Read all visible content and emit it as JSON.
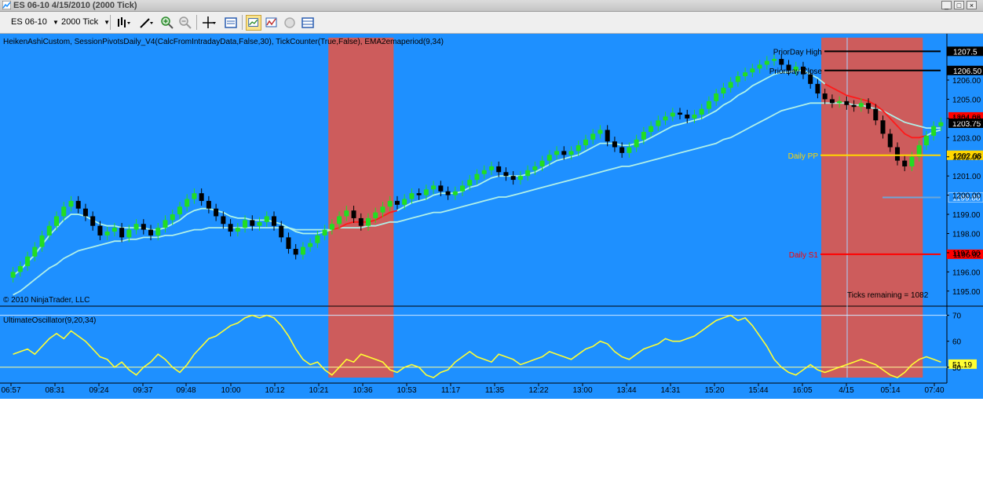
{
  "window": {
    "title": "ES 06-10  4/15/2010 (2000 Tick)"
  },
  "toolbar": {
    "instrument": "ES 06-10",
    "interval": "2000 Tick",
    "icons": [
      "bar-type-icon",
      "draw-pen-icon",
      "zoom-in-icon",
      "zoom-out-icon",
      "crosshair-icon",
      "data-box-icon",
      "strategy-icon",
      "indicator-icon",
      "properties-icon",
      "grid-icon"
    ]
  },
  "colors": {
    "background": "#1e90ff",
    "session_shade": "#cd5c5c",
    "candle_up": "#22dd22",
    "candle_down": "#000000",
    "ema_fast": "#aff5e8",
    "ema_slow": "#b0f0e8",
    "oscillator": "#ffff33",
    "pivot": "#ffd700",
    "s1": "#ff0000",
    "resistance": "#000000"
  },
  "price_panel": {
    "indicator_label": "HeikenAshiCustom, SessionPivotsDaily_V4(CalcFromIntradayData,False,30), TickCounter(True,False), EMA2emaperiod(9,34)",
    "copyright": "© 2010 NinjaTrader, LLC",
    "ticks_remaining": "Ticks remaining = 1082",
    "pivots": [
      {
        "label": "PriorDay High",
        "value": 1207.5,
        "tag": "1207.5",
        "color": "#000000"
      },
      {
        "label": "PriorDay Close",
        "value": 1206.5,
        "tag": "1206.50",
        "color": "#000000"
      },
      {
        "label": "Daily PP",
        "value": 1202.08,
        "tag": "1202.08",
        "color": "#ffd700"
      },
      {
        "label": "Daily S1",
        "value": 1196.92,
        "tag": "1196.92",
        "color": "#ff0000"
      }
    ],
    "price_tags": [
      {
        "value": 1204.08,
        "tag": "1204.08",
        "bg": "#ff0000",
        "fg": "#000000"
      },
      {
        "value": 1203.75,
        "tag": "1203.75",
        "bg": "#000000",
        "fg": "#ffffff"
      },
      {
        "value": 1199.88,
        "tag": "1199.88",
        "bg": "#1e90ff",
        "fg": "#ffffff"
      }
    ],
    "axis_ticks": [
      "1206.00",
      "1205.00",
      "1204.00",
      "1203.00",
      "1202.00",
      "1201.00",
      "1200.00",
      "1199.00",
      "1198.00",
      "1197.00",
      "1196.00",
      "1195.00"
    ]
  },
  "oscillator_panel": {
    "label": "UltimateOscillator(9,20,34)",
    "current_value": "51.19",
    "axis_ticks": [
      "70",
      "60",
      "50"
    ]
  },
  "time_axis": [
    "06:57",
    "08:31",
    "09:24",
    "09:37",
    "09:48",
    "10:00",
    "10:12",
    "10:21",
    "10:36",
    "10:53",
    "11:17",
    "11:35",
    "12:22",
    "13:00",
    "13:44",
    "14:31",
    "15:20",
    "15:44",
    "16:05",
    "4/15",
    "05:14",
    "07:40"
  ],
  "chart_data": {
    "type": "candlestick",
    "y_range": [
      1194.5,
      1207.8
    ],
    "oscillator_range": [
      46,
      72
    ],
    "oscillator_reference_lines": [
      70,
      50
    ],
    "candles_close": [
      1196.0,
      1196.3,
      1196.8,
      1197.3,
      1197.9,
      1198.4,
      1198.9,
      1199.4,
      1199.7,
      1199.3,
      1198.9,
      1198.4,
      1197.9,
      1198.1,
      1198.3,
      1197.8,
      1198.2,
      1198.5,
      1198.2,
      1197.9,
      1198.3,
      1198.7,
      1199.0,
      1199.4,
      1199.8,
      1200.1,
      1199.7,
      1199.3,
      1198.9,
      1198.5,
      1198.1,
      1198.3,
      1198.7,
      1198.4,
      1198.6,
      1198.9,
      1198.4,
      1197.8,
      1197.2,
      1196.9,
      1197.3,
      1197.5,
      1197.9,
      1198.2,
      1198.5,
      1198.9,
      1199.2,
      1198.8,
      1198.4,
      1198.8,
      1199.1,
      1199.4,
      1199.7,
      1199.5,
      1199.8,
      1200.1,
      1200.0,
      1200.3,
      1200.5,
      1200.2,
      1200.0,
      1200.2,
      1200.5,
      1200.8,
      1201.1,
      1201.3,
      1201.5,
      1201.2,
      1201.0,
      1200.8,
      1201.0,
      1201.3,
      1201.5,
      1201.8,
      1202.1,
      1202.3,
      1202.1,
      1202.3,
      1202.6,
      1202.9,
      1203.2,
      1203.4,
      1202.8,
      1202.5,
      1202.2,
      1202.5,
      1202.9,
      1203.3,
      1203.6,
      1203.9,
      1204.1,
      1204.3,
      1204.2,
      1204.0,
      1204.2,
      1204.5,
      1204.9,
      1205.3,
      1205.6,
      1205.9,
      1206.2,
      1206.4,
      1206.6,
      1206.8,
      1207.0,
      1207.1,
      1206.8,
      1206.5,
      1206.7,
      1206.3,
      1205.8,
      1205.3,
      1205.0,
      1204.8,
      1204.9,
      1204.7,
      1204.6,
      1204.8,
      1204.5,
      1203.9,
      1203.2,
      1202.5,
      1201.8,
      1201.5,
      1202.0,
      1202.6,
      1203.1,
      1203.6,
      1203.8
    ],
    "ema_fast": [
      1195.8,
      1196.1,
      1196.5,
      1196.9,
      1197.4,
      1197.9,
      1198.3,
      1198.7,
      1199.0,
      1199.0,
      1198.9,
      1198.7,
      1198.5,
      1198.4,
      1198.4,
      1198.3,
      1198.3,
      1198.3,
      1198.3,
      1198.2,
      1198.2,
      1198.3,
      1198.5,
      1198.7,
      1199.0,
      1199.2,
      1199.3,
      1199.3,
      1199.2,
      1199.1,
      1198.9,
      1198.8,
      1198.8,
      1198.7,
      1198.7,
      1198.7,
      1198.6,
      1198.5,
      1198.3,
      1198.1,
      1198.0,
      1198.0,
      1198.0,
      1198.1,
      1198.2,
      1198.3,
      1198.5,
      1198.6,
      1198.6,
      1198.6,
      1198.7,
      1198.9,
      1199.1,
      1199.2,
      1199.4,
      1199.6,
      1199.7,
      1199.8,
      1200.0,
      1200.1,
      1200.1,
      1200.1,
      1200.2,
      1200.4,
      1200.5,
      1200.7,
      1200.9,
      1201.0,
      1201.0,
      1201.0,
      1201.0,
      1201.1,
      1201.2,
      1201.4,
      1201.6,
      1201.8,
      1201.9,
      1202.0,
      1202.1,
      1202.3,
      1202.5,
      1202.7,
      1202.7,
      1202.7,
      1202.6,
      1202.6,
      1202.7,
      1202.8,
      1203.0,
      1203.2,
      1203.4,
      1203.6,
      1203.7,
      1203.8,
      1203.9,
      1204.0,
      1204.2,
      1204.4,
      1204.7,
      1204.9,
      1205.2,
      1205.4,
      1205.7,
      1205.9,
      1206.1,
      1206.3,
      1206.4,
      1206.4,
      1206.5,
      1206.5,
      1206.3,
      1206.1,
      1205.8,
      1205.6,
      1205.4,
      1205.2,
      1205.1,
      1205.0,
      1204.9,
      1204.7,
      1204.4,
      1204.0,
      1203.6,
      1203.2,
      1203.0,
      1203.0,
      1203.1,
      1203.3,
      1203.4
    ],
    "ema_slow": [
      1194.8,
      1195.0,
      1195.3,
      1195.6,
      1195.9,
      1196.2,
      1196.4,
      1196.7,
      1196.9,
      1197.1,
      1197.2,
      1197.3,
      1197.4,
      1197.5,
      1197.6,
      1197.6,
      1197.7,
      1197.7,
      1197.8,
      1197.8,
      1197.8,
      1197.9,
      1197.9,
      1198.0,
      1198.1,
      1198.2,
      1198.2,
      1198.3,
      1198.3,
      1198.3,
      1198.3,
      1198.3,
      1198.3,
      1198.3,
      1198.3,
      1198.3,
      1198.3,
      1198.3,
      1198.3,
      1198.2,
      1198.2,
      1198.2,
      1198.2,
      1198.2,
      1198.2,
      1198.3,
      1198.3,
      1198.3,
      1198.3,
      1198.4,
      1198.4,
      1198.5,
      1198.6,
      1198.6,
      1198.7,
      1198.8,
      1198.9,
      1199.0,
      1199.1,
      1199.1,
      1199.2,
      1199.3,
      1199.4,
      1199.5,
      1199.6,
      1199.7,
      1199.8,
      1199.9,
      1199.9,
      1200.0,
      1200.1,
      1200.2,
      1200.3,
      1200.4,
      1200.5,
      1200.6,
      1200.7,
      1200.8,
      1200.9,
      1201.0,
      1201.1,
      1201.2,
      1201.3,
      1201.4,
      1201.5,
      1201.5,
      1201.6,
      1201.7,
      1201.8,
      1201.9,
      1202.0,
      1202.1,
      1202.2,
      1202.3,
      1202.4,
      1202.5,
      1202.6,
      1202.7,
      1202.9,
      1203.0,
      1203.2,
      1203.4,
      1203.6,
      1203.8,
      1204.0,
      1204.2,
      1204.4,
      1204.5,
      1204.6,
      1204.7,
      1204.8,
      1204.8,
      1204.8,
      1204.8,
      1204.8,
      1204.8,
      1204.7,
      1204.7,
      1204.6,
      1204.5,
      1204.4,
      1204.2,
      1204.0,
      1203.8,
      1203.7,
      1203.6,
      1203.5,
      1203.5,
      1203.5
    ],
    "oscillator": [
      55,
      56,
      57,
      55,
      58,
      61,
      63,
      61,
      64,
      62,
      60,
      57,
      54,
      53,
      50,
      52,
      49,
      47,
      50,
      52,
      55,
      53,
      50,
      48,
      51,
      55,
      58,
      61,
      62,
      64,
      66,
      67,
      69,
      70,
      69,
      70,
      69,
      66,
      62,
      57,
      53,
      51,
      52,
      49,
      47,
      50,
      53,
      52,
      55,
      54,
      53,
      52,
      49,
      48,
      50,
      51,
      50,
      47,
      46,
      48,
      49,
      52,
      54,
      56,
      54,
      53,
      52,
      55,
      54,
      53,
      51,
      52,
      53,
      54,
      56,
      55,
      54,
      53,
      55,
      57,
      58,
      60,
      59,
      56,
      54,
      53,
      55,
      57,
      58,
      59,
      61,
      60,
      60,
      61,
      62,
      64,
      66,
      68,
      69,
      70,
      68,
      69,
      66,
      62,
      58,
      53,
      50,
      48,
      47,
      49,
      51,
      49,
      48,
      49,
      50,
      51,
      52,
      53,
      52,
      51,
      49,
      47,
      46,
      48,
      51,
      53,
      54,
      53,
      52
    ],
    "shaded_sessions": [
      [
        44,
        53
      ],
      [
        112,
        126
      ]
    ]
  }
}
